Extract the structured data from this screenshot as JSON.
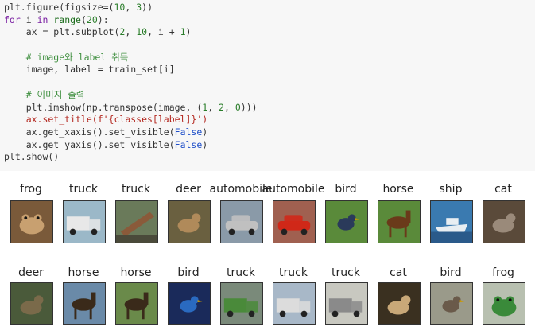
{
  "code": {
    "lines": [
      [
        {
          "t": "plt.figure(figsize=(",
          "c": ""
        },
        {
          "t": "10",
          "c": "num"
        },
        {
          "t": ", ",
          "c": ""
        },
        {
          "t": "3",
          "c": "num"
        },
        {
          "t": "))",
          "c": ""
        }
      ],
      [
        {
          "t": "for",
          "c": "kw"
        },
        {
          "t": " i ",
          "c": ""
        },
        {
          "t": "in",
          "c": "kw"
        },
        {
          "t": " ",
          "c": ""
        },
        {
          "t": "range",
          "c": "bi"
        },
        {
          "t": "(",
          "c": ""
        },
        {
          "t": "20",
          "c": "num"
        },
        {
          "t": "):",
          "c": ""
        }
      ],
      [
        {
          "t": "    ax = plt.subplot(",
          "c": ""
        },
        {
          "t": "2",
          "c": "num"
        },
        {
          "t": ", ",
          "c": ""
        },
        {
          "t": "10",
          "c": "num"
        },
        {
          "t": ", i + ",
          "c": ""
        },
        {
          "t": "1",
          "c": "num"
        },
        {
          "t": ")",
          "c": ""
        }
      ],
      [
        {
          "t": "",
          "c": ""
        }
      ],
      [
        {
          "t": "    # image와 label 취득",
          "c": "cm"
        }
      ],
      [
        {
          "t": "    image, label = train_set[i]",
          "c": ""
        }
      ],
      [
        {
          "t": "",
          "c": ""
        }
      ],
      [
        {
          "t": "    # 이미지 출력",
          "c": "cm"
        }
      ],
      [
        {
          "t": "    plt.imshow(np.transpose(image, (",
          "c": ""
        },
        {
          "t": "1",
          "c": "num"
        },
        {
          "t": ", ",
          "c": ""
        },
        {
          "t": "2",
          "c": "num"
        },
        {
          "t": ", ",
          "c": ""
        },
        {
          "t": "0",
          "c": "num"
        },
        {
          "t": ")))",
          "c": ""
        }
      ],
      [
        {
          "t": "    ax.set_title(f'{classes[label]}')",
          "c": "st"
        }
      ],
      [
        {
          "t": "    ax.get_xaxis().set_visible(",
          "c": ""
        },
        {
          "t": "False",
          "c": "bl"
        },
        {
          "t": ")",
          "c": ""
        }
      ],
      [
        {
          "t": "    ax.get_yaxis().set_visible(",
          "c": ""
        },
        {
          "t": "False",
          "c": "bl"
        },
        {
          "t": ")",
          "c": ""
        }
      ],
      [
        {
          "t": "plt.show()",
          "c": ""
        }
      ]
    ]
  },
  "output": {
    "row1": [
      {
        "label": "frog",
        "icon": "frog-image",
        "bg": "#7a5a3a",
        "fg": "#c8a070",
        "shape": "frog"
      },
      {
        "label": "truck",
        "icon": "truck-image",
        "bg": "#9bb8c8",
        "fg": "#e8e8e8",
        "shape": "truck"
      },
      {
        "label": "truck",
        "icon": "truck-image",
        "bg": "#6a7a5a",
        "fg": "#8a5a3a",
        "shape": "log"
      },
      {
        "label": "deer",
        "icon": "deer-image",
        "bg": "#6a6040",
        "fg": "#b08a5a",
        "shape": "animal"
      },
      {
        "label": "automobile",
        "icon": "automobile-image",
        "bg": "#8a9aa8",
        "fg": "#c0c0c0",
        "shape": "car"
      },
      {
        "label": "automobile",
        "icon": "automobile-image",
        "bg": "#a06050",
        "fg": "#d02818",
        "shape": "car"
      },
      {
        "label": "bird",
        "icon": "bird-image",
        "bg": "#5a8a3a",
        "fg": "#2a3a5a",
        "shape": "bird"
      },
      {
        "label": "horse",
        "icon": "horse-image",
        "bg": "#5a8a3a",
        "fg": "#6a3a1a",
        "shape": "horse"
      },
      {
        "label": "ship",
        "icon": "ship-image",
        "bg": "#3a7ab0",
        "fg": "#e8eef2",
        "shape": "ship"
      },
      {
        "label": "cat",
        "icon": "cat-image",
        "bg": "#5a4a3a",
        "fg": "#9a8a7a",
        "shape": "animal"
      }
    ],
    "row2": [
      {
        "label": "deer",
        "icon": "deer-image",
        "bg": "#4a5a3a",
        "fg": "#7a6a4a",
        "shape": "animal"
      },
      {
        "label": "horse",
        "icon": "horse-image",
        "bg": "#6a8aa8",
        "fg": "#3a2a1a",
        "shape": "horse"
      },
      {
        "label": "horse",
        "icon": "horse-image",
        "bg": "#6a8a4a",
        "fg": "#3a2a1a",
        "shape": "horse"
      },
      {
        "label": "bird",
        "icon": "bird-image",
        "bg": "#1a2a5a",
        "fg": "#2a6ac0",
        "shape": "bird"
      },
      {
        "label": "truck",
        "icon": "truck-image",
        "bg": "#7a8a7a",
        "fg": "#4a8a3a",
        "shape": "truck"
      },
      {
        "label": "truck",
        "icon": "truck-image",
        "bg": "#a8b8c8",
        "fg": "#dcdcdc",
        "shape": "truck"
      },
      {
        "label": "truck",
        "icon": "truck-image",
        "bg": "#c8c8c0",
        "fg": "#8a8a8a",
        "shape": "truck"
      },
      {
        "label": "cat",
        "icon": "cat-image",
        "bg": "#3a3020",
        "fg": "#c8a878",
        "shape": "animal"
      },
      {
        "label": "bird",
        "icon": "bird-image",
        "bg": "#9a9a8a",
        "fg": "#6a5a4a",
        "shape": "bird"
      },
      {
        "label": "frog",
        "icon": "frog-image",
        "bg": "#b8c0b0",
        "fg": "#3a8a3a",
        "shape": "frog"
      }
    ]
  }
}
